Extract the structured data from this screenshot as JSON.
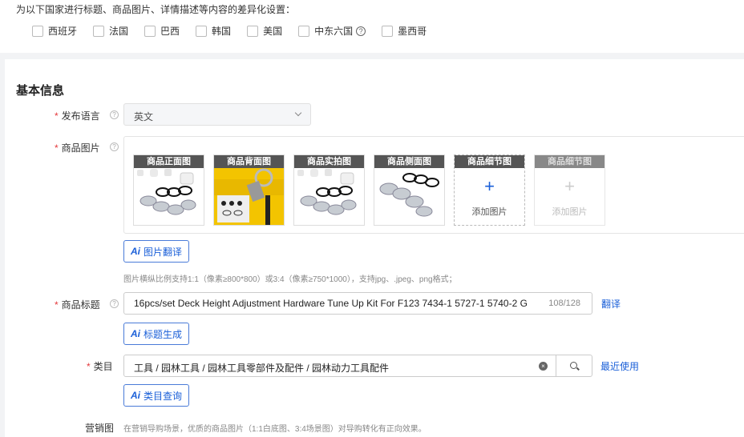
{
  "top": {
    "title": "为以下国家进行标题、商品图片、详情描述等内容的差异化设置：",
    "countries": [
      "西班牙",
      "法国",
      "巴西",
      "韩国",
      "美国",
      "中东六国",
      "墨西哥"
    ]
  },
  "section_title": "基本信息",
  "lang": {
    "label": "发布语言",
    "value": "英文"
  },
  "images": {
    "label": "商品图片",
    "slots": [
      {
        "title": "商品正面图"
      },
      {
        "title": "商品背面图"
      },
      {
        "title": "商品实拍图"
      },
      {
        "title": "商品侧面图"
      },
      {
        "title": "商品细节图",
        "add_text": "添加图片"
      },
      {
        "title": "商品细节图",
        "add_text": "添加图片"
      }
    ],
    "translate_button": "图片翻译",
    "hint": "图片横纵比例支持1:1（像素≥800*800）或3:4（像素≥750*1000），支持jpg、.jpeg、png格式；"
  },
  "product_title": {
    "label": "商品标题",
    "value": "16pcs/set Deck Height Adjustment Hardware Tune Up Kit For F123 7434-1 5727-1 5740-2 G",
    "count": "108/128",
    "translate_link": "翻译",
    "generate_button": "标题生成"
  },
  "category": {
    "label": "类目",
    "value": "工具 / 园林工具 / 园林工具零部件及配件 / 园林动力工具配件",
    "recent_link": "最近使用",
    "query_button": "类目查询"
  },
  "marketing": {
    "label": "营销图",
    "hint": "在营销导购场景，优质的商品图片（1:1白底图、3:4场景图）对导购转化有正向效果。"
  },
  "ai_mark": "Ai"
}
